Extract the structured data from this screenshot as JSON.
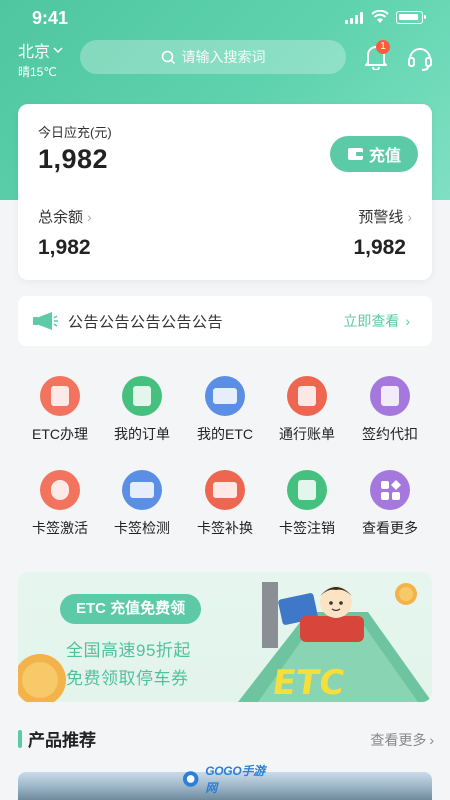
{
  "status_bar": {
    "time": "9:41"
  },
  "location": {
    "city": "北京",
    "weather": "晴15℃"
  },
  "search": {
    "placeholder": "请输入搜索词"
  },
  "notifications": {
    "badge_count": "1"
  },
  "account": {
    "today_label": "今日应充(元)",
    "today_amount": "1,982",
    "recharge_button": "充值",
    "balance_label": "总余额",
    "balance_value": "1,982",
    "warning_label": "预警线",
    "warning_value": "1,982"
  },
  "notice": {
    "text": "公告公告公告公告公告",
    "link": "立即查看"
  },
  "services": [
    {
      "label": "ETC办理",
      "icon": "etc-apply-icon",
      "color": "#f2745f"
    },
    {
      "label": "我的订单",
      "icon": "order-icon",
      "color": "#45c07f"
    },
    {
      "label": "我的ETC",
      "icon": "etc-card-icon",
      "color": "#5b8fe6"
    },
    {
      "label": "通行账单",
      "icon": "bill-icon",
      "color": "#ef6650"
    },
    {
      "label": "签约代扣",
      "icon": "sign-icon",
      "color": "#a478dc"
    },
    {
      "label": "卡签激活",
      "icon": "activate-icon",
      "color": "#f2745f"
    },
    {
      "label": "卡签检测",
      "icon": "detect-icon",
      "color": "#5b8fe6"
    },
    {
      "label": "卡签补换",
      "icon": "replace-icon",
      "color": "#ef6650"
    },
    {
      "label": "卡签注销",
      "icon": "cancel-icon",
      "color": "#45c07f"
    },
    {
      "label": "查看更多",
      "icon": "more-icon",
      "color": "#a478dc"
    }
  ],
  "banner": {
    "tag": "ETC 充值免费领",
    "line1": "全国高速95折起",
    "line2": "免费领取停车券",
    "road_text": "ETC"
  },
  "products": {
    "title": "产品推荐",
    "more": "查看更多"
  },
  "watermark": {
    "text": "GOGO手游网"
  },
  "colors": {
    "primary": "#5ccaa6",
    "badge": "#ff5a3c"
  }
}
